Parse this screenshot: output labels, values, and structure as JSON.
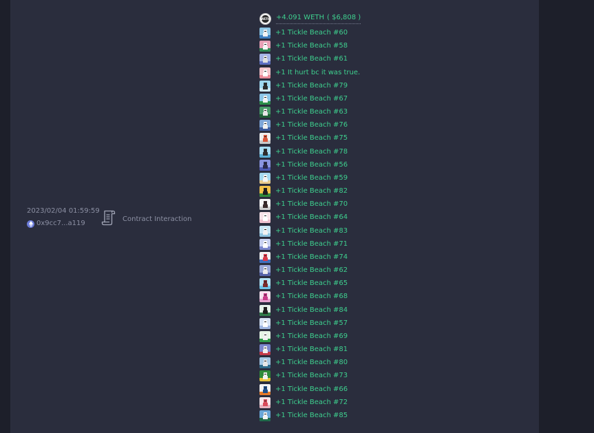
{
  "transaction": {
    "timestamp": "2023/02/04 01:59:59",
    "address": "0x9cc7...a119",
    "chain_icon": "ethereum-icon",
    "method_icon": "scroll-icon",
    "method": "Contract Interaction"
  },
  "weth_transfer": {
    "icon": "weth-icon",
    "icon_text": "WETH",
    "amount": "+4.091 WETH",
    "usd": "( $6,808 )"
  },
  "nft_transfers": [
    {
      "text": "+1 Tickle Beach #60",
      "sky": "#8ec7e6",
      "ground": "#3f7fbf",
      "figure": "#f2f2f2"
    },
    {
      "text": "+1 Tickle Beach #58",
      "sky": "#e8a0b6",
      "ground": "#2f8a54",
      "figure": "#f5f5f5"
    },
    {
      "text": "+1 Tickle Beach #61",
      "sky": "#a6b4e6",
      "ground": "#5e6fc2",
      "figure": "#e0e0e0"
    },
    {
      "text": "+1 It hurt bc it was true.",
      "sky": "#f5c6cc",
      "ground": "#e98a98",
      "figure": "#ffffff"
    },
    {
      "text": "+1 Tickle Beach #79",
      "sky": "#9fd8f0",
      "ground": "#cfeaf5",
      "figure": "#2d2d2d"
    },
    {
      "text": "+1 Tickle Beach #67",
      "sky": "#8cc6e8",
      "ground": "#2c8f4a",
      "figure": "#f2f2f2"
    },
    {
      "text": "+1 Tickle Beach #63",
      "sky": "#4a9c6a",
      "ground": "#1f5f36",
      "figure": "#e6e6e6"
    },
    {
      "text": "+1 Tickle Beach #76",
      "sky": "#7ea6d8",
      "ground": "#3a5a9e",
      "figure": "#f0f0f0"
    },
    {
      "text": "+1 Tickle Beach #75",
      "sky": "#eeeeee",
      "ground": "#c9c9c9",
      "figure": "#d8553a"
    },
    {
      "text": "+1 Tickle Beach #78",
      "sky": "#a8dcf2",
      "ground": "#5bb0d6",
      "figure": "#2d2d2d"
    },
    {
      "text": "+1 Tickle Beach #56",
      "sky": "#8a94e0",
      "ground": "#4d58b3",
      "figure": "#2a2a4a"
    },
    {
      "text": "+1 Tickle Beach #59",
      "sky": "#a6d9f0",
      "ground": "#e7c98c",
      "figure": "#f4f4f4"
    },
    {
      "text": "+1 Tickle Beach #82",
      "sky": "#f2c14a",
      "ground": "#2f8a3a",
      "figure": "#1f1f1f"
    },
    {
      "text": "+1 Tickle Beach #70",
      "sky": "#f5f5f5",
      "ground": "#d0d0d0",
      "figure": "#3a2a2a"
    },
    {
      "text": "+1 Tickle Beach #64",
      "sky": "#f7e2e8",
      "ground": "#efc1cf",
      "figure": "#ffffff"
    },
    {
      "text": "+1 Tickle Beach #83",
      "sky": "#c7e6f5",
      "ground": "#8fc4e0",
      "figure": "#f2f2f2"
    },
    {
      "text": "+1 Tickle Beach #71",
      "sky": "#c9d2f2",
      "ground": "#7a86cc",
      "figure": "#ffffff"
    },
    {
      "text": "+1 Tickle Beach #74",
      "sky": "#f2f2f2",
      "ground": "#3f6fbf",
      "figure": "#d83a4a"
    },
    {
      "text": "+1 Tickle Beach #62",
      "sky": "#9aa8d8",
      "ground": "#5663a8",
      "figure": "#ececec"
    },
    {
      "text": "+1 Tickle Beach #65",
      "sky": "#b3e3f5",
      "ground": "#6fc3e6",
      "figure": "#7a2a2a"
    },
    {
      "text": "+1 Tickle Beach #68",
      "sky": "#f6e2f0",
      "ground": "#e6a3cf",
      "figure": "#c83a8a"
    },
    {
      "text": "+1 Tickle Beach #84",
      "sky": "#e6f2ea",
      "ground": "#2f7a4a",
      "figure": "#1f1f1f"
    },
    {
      "text": "+1 Tickle Beach #57",
      "sky": "#d7e4f5",
      "ground": "#9fb6e0",
      "figure": "#ffffff"
    },
    {
      "text": "+1 Tickle Beach #69",
      "sky": "#e6f5e6",
      "ground": "#2f9a4a",
      "figure": "#f2f2f2"
    },
    {
      "text": "+1 Tickle Beach #81",
      "sky": "#7a86cc",
      "ground": "#c23a4a",
      "figure": "#f0f0f0"
    },
    {
      "text": "+1 Tickle Beach #80",
      "sky": "#a6c9e6",
      "ground": "#2f6a8a",
      "figure": "#e6e6e6"
    },
    {
      "text": "+1 Tickle Beach #73",
      "sky": "#2f8a3a",
      "ground": "#e6c23a",
      "figure": "#f2f2f2"
    },
    {
      "text": "+1 Tickle Beach #66",
      "sky": "#f2f2f2",
      "ground": "#e67a2a",
      "figure": "#1f4f8a"
    },
    {
      "text": "+1 Tickle Beach #72",
      "sky": "#f6e6ea",
      "ground": "#e6b3bf",
      "figure": "#d84a5a"
    },
    {
      "text": "+1 Tickle Beach #85",
      "sky": "#6aa6d8",
      "ground": "#1f6a4a",
      "figure": "#f2f2f2"
    }
  ]
}
